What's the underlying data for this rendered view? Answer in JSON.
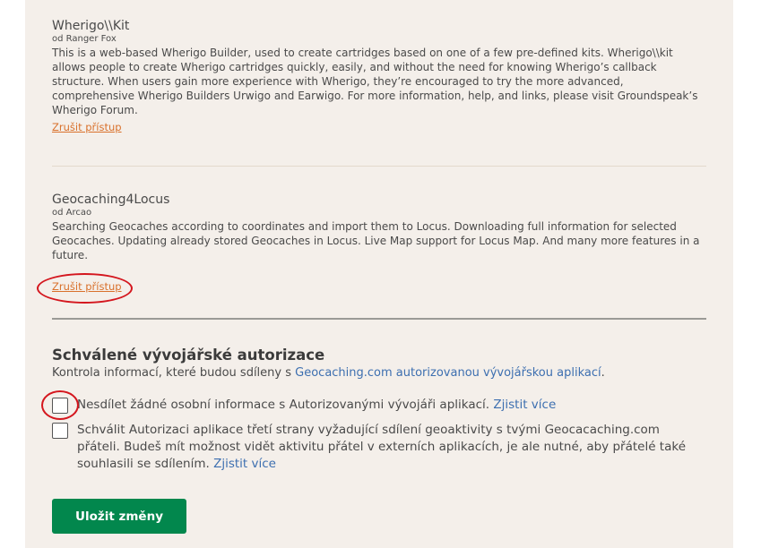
{
  "apps": [
    {
      "name": "Wherigo\\\\Kit",
      "author": "od Ranger Fox",
      "description": "This is a web-based Wherigo Builder, used to create cartridges based on one of a few pre-defined kits. Wherigo\\\\kit allows people to create Wherigo cartridges quickly, easily, and without the need for knowing Wherigo’s callback structure. When users gain more experience with Wherigo, they’re encouraged to try the more advanced, comprehensive Wherigo Builders Urwigo and Earwigo. For more information, help, and links, please visit Groundspeak’s Wherigo Forum.",
      "revoke_label": "Zrušit přístup"
    },
    {
      "name": "Geocaching4Locus",
      "author": "od Arcao",
      "description": "Searching Geocaches according to coordinates and import them to Locus. Downloading full information for selected Geocaches. Updating already stored Geocaches in Locus. Live Map support for Locus Map. And many more features in a future.",
      "revoke_label": "Zrušit přístup"
    }
  ],
  "authorizations": {
    "title": "Schválené vývojářské autorizace",
    "description_prefix": "Kontrola informací, které budou sdíleny s ",
    "description_link": "Geocaching.com autorizovanou vývojářskou aplikací",
    "description_suffix": ".",
    "options": [
      {
        "text": "Nesdílet žádné osobní informace s Autorizovanými vývojáři aplikací. ",
        "link": "Zjistit více",
        "checked": false
      },
      {
        "text": "Schválit Autorizaci aplikace třetí strany vyžadující sdílení geoaktivity s tvými Geocacaching.com přáteli. Budeš mít možnost vidět aktivitu přátel v externích aplikacích, je ale nutné, aby přátelé také souhlasili se sdílením. ",
        "link": "Zjistit více",
        "checked": false
      }
    ]
  },
  "save_label": "Uložit změny",
  "colors": {
    "panel_bg": "#f4efea",
    "revoke_link": "#d9712c",
    "link": "#3d6fb0",
    "save_button": "#02874d",
    "annotation": "#d4161e"
  }
}
